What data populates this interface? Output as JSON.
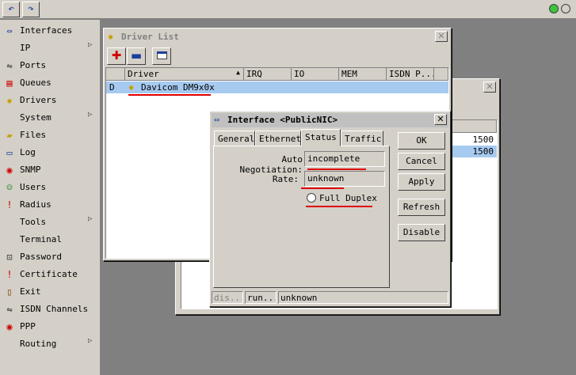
{
  "toolbar": {
    "undo_glyph": "↶",
    "redo_glyph": "↷"
  },
  "sidebar": {
    "items": [
      {
        "label": "Interfaces",
        "icon": "interfaces-icon",
        "arrow": false
      },
      {
        "label": "IP",
        "icon": "",
        "arrow": true
      },
      {
        "label": "Ports",
        "icon": "ports-icon",
        "arrow": false
      },
      {
        "label": "Queues",
        "icon": "queues-icon",
        "arrow": false
      },
      {
        "label": "Drivers",
        "icon": "drivers-icon",
        "arrow": false
      },
      {
        "label": "System",
        "icon": "",
        "arrow": true
      },
      {
        "label": "Files",
        "icon": "files-icon",
        "arrow": false
      },
      {
        "label": "Log",
        "icon": "log-icon",
        "arrow": false
      },
      {
        "label": "SNMP",
        "icon": "snmp-icon",
        "arrow": false
      },
      {
        "label": "Users",
        "icon": "users-icon",
        "arrow": false
      },
      {
        "label": "Radius",
        "icon": "radius-icon",
        "arrow": false
      },
      {
        "label": "Tools",
        "icon": "",
        "arrow": true
      },
      {
        "label": "Terminal",
        "icon": "",
        "arrow": false
      },
      {
        "label": "Password",
        "icon": "password-icon",
        "arrow": false
      },
      {
        "label": "Certificate",
        "icon": "certificate-icon",
        "arrow": false
      },
      {
        "label": "Exit",
        "icon": "exit-icon",
        "arrow": false
      },
      {
        "label": "ISDN Channels",
        "icon": "isdn-icon",
        "arrow": false
      },
      {
        "label": "PPP",
        "icon": "ppp-icon",
        "arrow": false
      },
      {
        "label": "Routing",
        "icon": "",
        "arrow": true
      }
    ]
  },
  "driver_list": {
    "title": "Driver List",
    "columns": [
      "Driver",
      "IRQ",
      "IO",
      "MEM",
      "ISDN P..."
    ],
    "rows": [
      {
        "flag": "D",
        "driver": "Davicom DM9x0x"
      }
    ]
  },
  "background_window": {
    "values": [
      "1500",
      "1500"
    ]
  },
  "interface_dialog": {
    "title": "Interface <PublicNIC>",
    "tabs": [
      "General",
      "Ethernet",
      "Status",
      "Traffic"
    ],
    "active_tab": "Status",
    "auto_negotiation_label": "Auto Negotiation:",
    "auto_negotiation_value": "incomplete",
    "rate_label": "Rate:",
    "rate_value": "unknown",
    "full_duplex_label": "Full Duplex",
    "buttons": {
      "ok": "OK",
      "cancel": "Cancel",
      "apply": "Apply",
      "refresh": "Refresh",
      "disable": "Disable"
    },
    "status_bar": [
      "dis...",
      "run...",
      "unknown"
    ]
  },
  "colors": {
    "highlight_row": "#a6caf0",
    "annotation_red": "#e00000",
    "desktop": "#808080"
  }
}
